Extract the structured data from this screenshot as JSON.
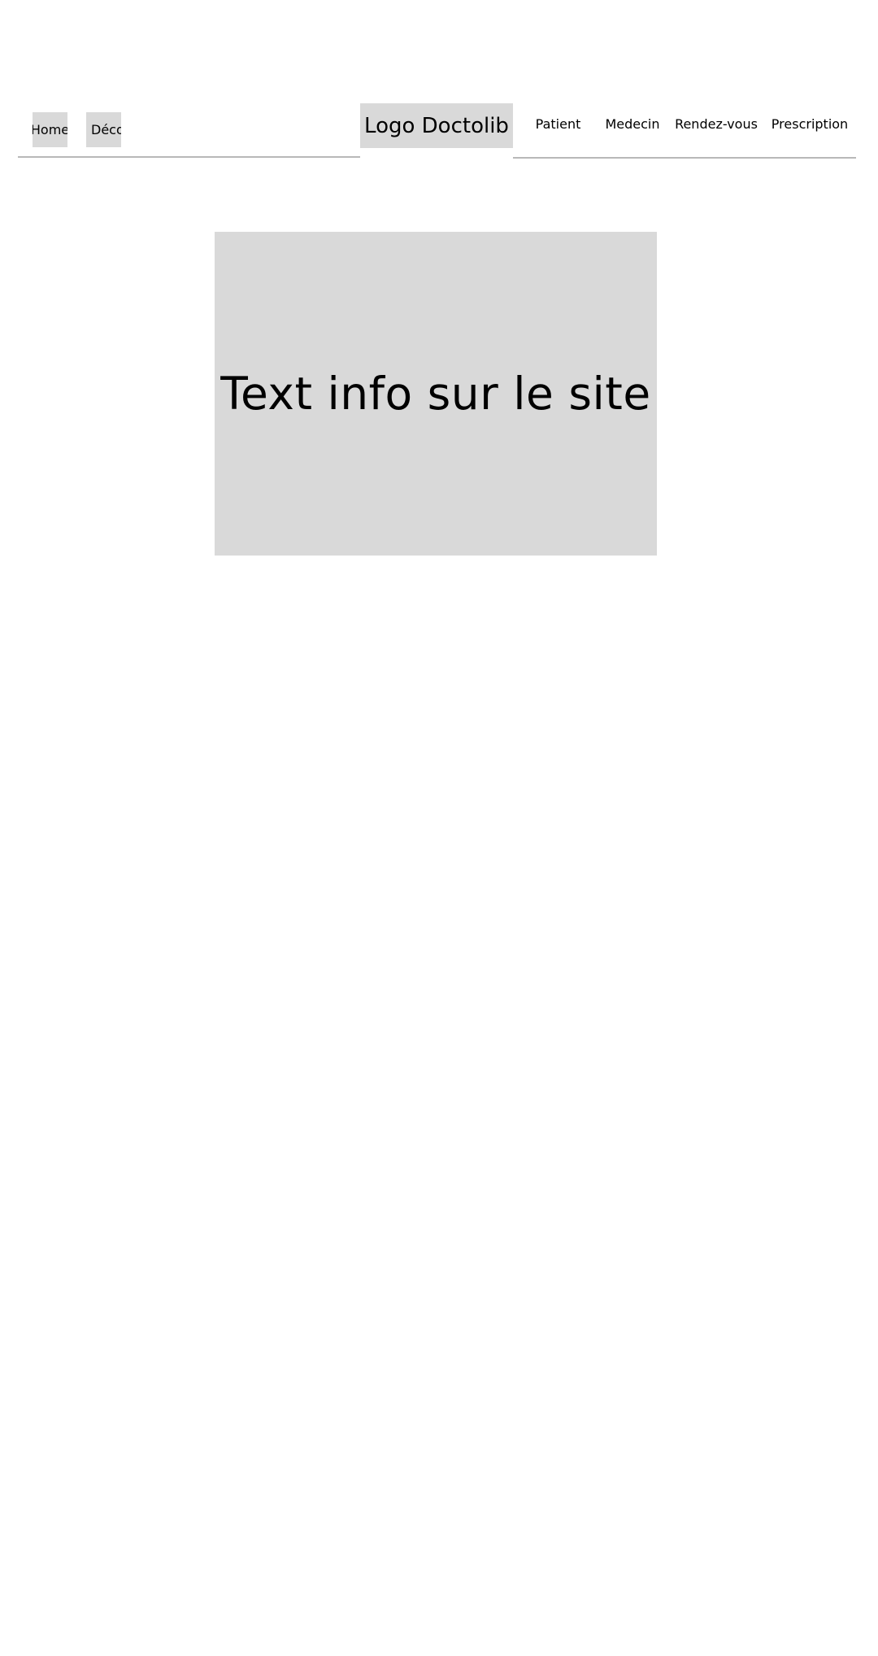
{
  "header": {
    "home_label": "Home",
    "deco_label": "Déco",
    "logo_label": "Logo Doctolib",
    "nav": [
      {
        "label": "Patient"
      },
      {
        "label": "Medecin"
      },
      {
        "label": "Rendez-vous"
      },
      {
        "label": "Prescription"
      }
    ]
  },
  "main": {
    "hero_text": "Text info sur le site"
  },
  "colors": {
    "placeholder_gray": "#d9d9d9",
    "divider_gray": "#b8b8b8",
    "background": "#ffffff"
  }
}
